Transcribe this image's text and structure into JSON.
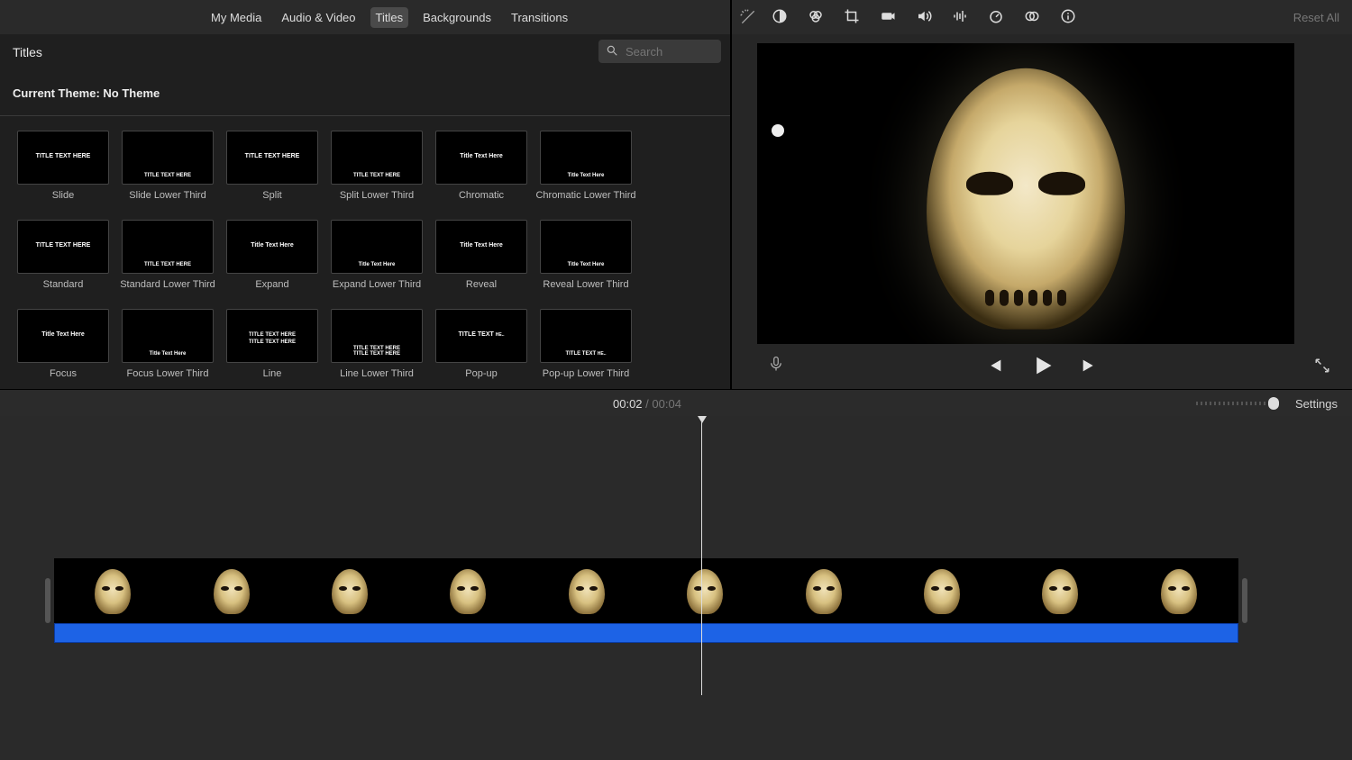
{
  "nav": {
    "tabs": [
      "My Media",
      "Audio & Video",
      "Titles",
      "Backgrounds",
      "Transitions"
    ],
    "active_index": 2
  },
  "sidebar_title": "Titles",
  "search": {
    "placeholder": "Search"
  },
  "theme_line": "Current Theme: No Theme",
  "thumb_sample_text": "TITLE TEXT HERE",
  "thumb_sample_mixed": "Title Text Here",
  "titles": [
    {
      "label": "Slide",
      "pos": "center",
      "style": "upper"
    },
    {
      "label": "Slide Lower Third",
      "pos": "lower",
      "style": "upper"
    },
    {
      "label": "Split",
      "pos": "center",
      "style": "upper"
    },
    {
      "label": "Split Lower Third",
      "pos": "lower",
      "style": "upper"
    },
    {
      "label": "Chromatic",
      "pos": "center",
      "style": "mixed"
    },
    {
      "label": "Chromatic Lower Third",
      "pos": "lower",
      "style": "mixed"
    },
    {
      "label": "Standard",
      "pos": "center",
      "style": "upper"
    },
    {
      "label": "Standard Lower Third",
      "pos": "lower",
      "style": "upper"
    },
    {
      "label": "Expand",
      "pos": "center",
      "style": "mixed"
    },
    {
      "label": "Expand Lower Third",
      "pos": "lower",
      "style": "mixed"
    },
    {
      "label": "Reveal",
      "pos": "center",
      "style": "mixed"
    },
    {
      "label": "Reveal Lower Third",
      "pos": "lower",
      "style": "mixed"
    },
    {
      "label": "Focus",
      "pos": "center",
      "style": "mixed"
    },
    {
      "label": "Focus Lower Third",
      "pos": "lower",
      "style": "mixed"
    },
    {
      "label": "Line",
      "pos": "center",
      "style": "line"
    },
    {
      "label": "Line Lower Third",
      "pos": "lower",
      "style": "line"
    },
    {
      "label": "Pop-up",
      "pos": "center",
      "style": "popup"
    },
    {
      "label": "Pop-up Lower Third",
      "pos": "lower",
      "style": "popup"
    }
  ],
  "tool_icons": [
    "color-balance-icon",
    "color-correction-icon",
    "crop-icon",
    "stabilization-icon",
    "volume-icon",
    "noise-reduction-eq-icon",
    "speed-icon",
    "clip-filter-icon",
    "info-icon"
  ],
  "reset_all": "Reset All",
  "transport": {
    "prev": "previous-frame",
    "play": "play",
    "next": "next-frame"
  },
  "time": {
    "current": "00:02",
    "sep": "/",
    "total": "00:04"
  },
  "settings": "Settings",
  "timeline_frame_count": 10
}
